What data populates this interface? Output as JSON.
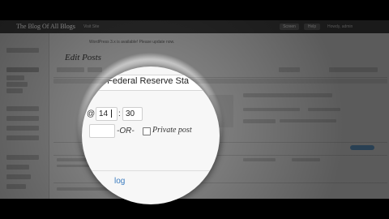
{
  "admin_bar": {
    "site_title": "The Blog Of All Blogs",
    "site_link": "Visit Site",
    "button_a": "Screen",
    "button_b": "Help",
    "howdy": "Howdy, admin"
  },
  "notice": "WordPress 3.x is available! Please update now.",
  "page": {
    "title": "Edit Posts"
  },
  "quick_edit": {
    "title_value": "e Federal Reserve Sta",
    "at_symbol": "@",
    "hour": "14",
    "minute": "30",
    "colon": ":",
    "or_label": "-OR-",
    "private_label": "Private post",
    "private_checked": false,
    "link_fragment": "log"
  },
  "colors": {
    "admin_bar": "#3a3a3a",
    "link_blue": "#3a7bbf",
    "update_button": "#5b8fb8"
  }
}
